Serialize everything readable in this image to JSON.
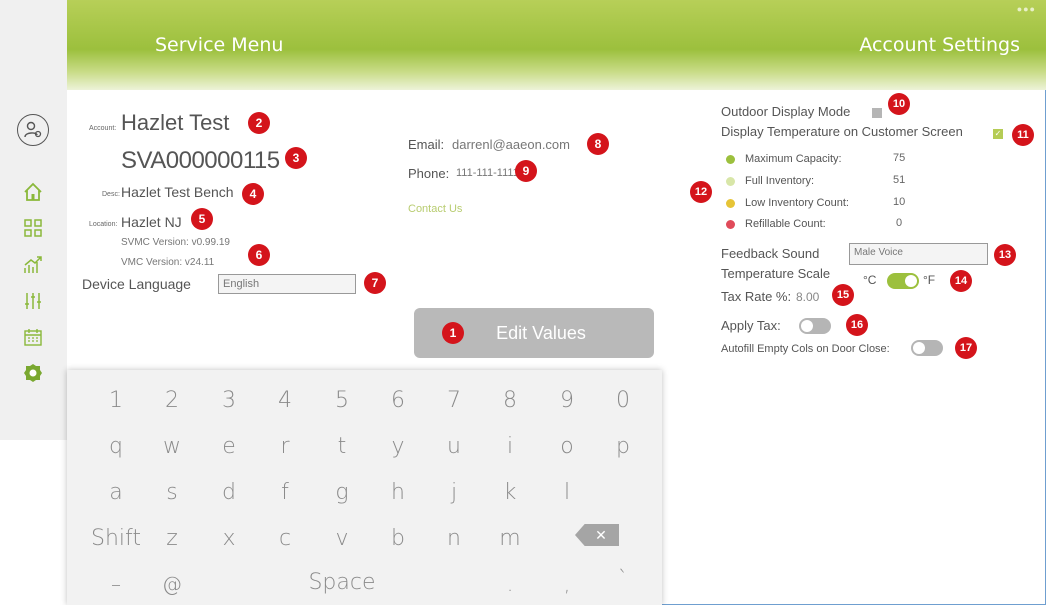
{
  "header": {
    "left_title": "Service Menu",
    "right_title": "Account Settings"
  },
  "colors": {
    "brand_green": "#9cc03d",
    "badge_red": "#d4141b",
    "dot_max": "#9cc03d",
    "dot_full": "#d8e6a8",
    "dot_low": "#e6c437",
    "dot_refill": "#e04b5a"
  },
  "sidebar": {
    "icons": [
      "user-settings-icon",
      "home-icon",
      "grid-icon",
      "growth-chart-icon",
      "sliders-icon",
      "calendar-icon",
      "gear-badge-icon"
    ]
  },
  "account": {
    "account_label": "Account:",
    "account_name": "Hazlet Test",
    "serial": "SVA000000115",
    "desc_label": "Desc:",
    "desc_value": "Hazlet Test Bench",
    "location_label": "Location:",
    "location_value": "Hazlet NJ",
    "svmc_version": "SVMC Version: v0.99.19",
    "vmc_version": "VMC Version: v24.11",
    "device_language_label": "Device Language",
    "device_language_value": "English"
  },
  "contact": {
    "email_label": "Email:",
    "email_value": "darrenl@aaeon.com",
    "phone_label": "Phone:",
    "phone_value": "111-111-1111",
    "contact_link": "Contact Us"
  },
  "edit_button": {
    "label": "Edit Values"
  },
  "settings": {
    "outdoor_display_mode_label": "Outdoor Display Mode",
    "outdoor_display_mode_checked": false,
    "display_temp_label": "Display Temperature on Customer Screen",
    "display_temp_checked": true,
    "inventory": [
      {
        "label": "Maximum Capacity:",
        "value": "75"
      },
      {
        "label": "Full Inventory:",
        "value": "51"
      },
      {
        "label": "Low Inventory Count:",
        "value": "10"
      },
      {
        "label": "Refillable Count:",
        "value": "0"
      }
    ],
    "feedback_sound_label": "Feedback Sound",
    "feedback_sound_value": "Male Voice",
    "temp_scale_label": "Temperature Scale",
    "temp_celsius": "°C",
    "temp_fahrenheit": "°F",
    "temp_scale_on": true,
    "tax_rate_label": "Tax Rate %:",
    "tax_rate_value": "8.00",
    "apply_tax_label": "Apply Tax:",
    "apply_tax_on": false,
    "autofill_label": "Autofill Empty Cols on Door Close:",
    "autofill_on": false
  },
  "badges": [
    "1",
    "2",
    "3",
    "4",
    "5",
    "6",
    "7",
    "8",
    "9",
    "10",
    "11",
    "12",
    "13",
    "14",
    "15",
    "16",
    "17"
  ],
  "keyboard": {
    "row1": [
      "1",
      "2",
      "3",
      "4",
      "5",
      "6",
      "7",
      "8",
      "9",
      "0"
    ],
    "row2": [
      "q",
      "w",
      "e",
      "r",
      "t",
      "y",
      "u",
      "i",
      "o",
      "p"
    ],
    "row3": [
      "a",
      "s",
      "d",
      "f",
      "g",
      "h",
      "j",
      "k",
      "l"
    ],
    "shift": "Shift",
    "row4": [
      "z",
      "x",
      "c",
      "v",
      "b",
      "n",
      "m"
    ],
    "backspace": "✕",
    "dash": "–",
    "at": "@",
    "space": "Space",
    "dot": ".",
    "comma": ",",
    "backtick": "`"
  }
}
